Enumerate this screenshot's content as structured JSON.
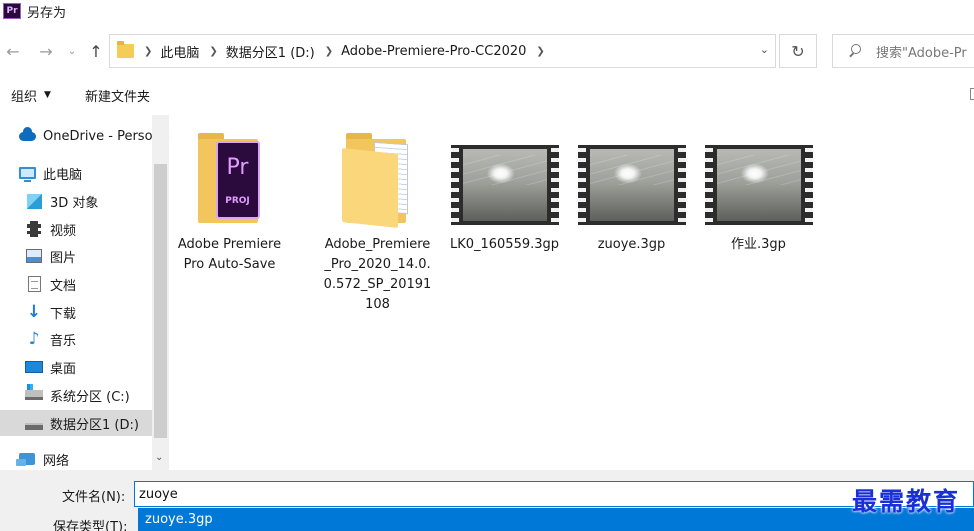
{
  "window": {
    "title": "另存为",
    "app_icon_text": "Pr"
  },
  "address": {
    "crumbs": [
      "此电脑",
      "数据分区1 (D:)",
      "Adobe-Premiere-Pro-CC2020"
    ],
    "search_placeholder": "搜索\"Adobe-Pr"
  },
  "toolbar": {
    "organize": "组织",
    "new_folder": "新建文件夹"
  },
  "nav": {
    "items": [
      {
        "label": "OneDrive - Personal",
        "icon": "onedrive-icon"
      },
      {
        "label": "此电脑",
        "icon": "this-pc-icon"
      },
      {
        "label": "3D 对象",
        "icon": "3d-objects-icon"
      },
      {
        "label": "视频",
        "icon": "videos-icon"
      },
      {
        "label": "图片",
        "icon": "pictures-icon"
      },
      {
        "label": "文档",
        "icon": "documents-icon"
      },
      {
        "label": "下载",
        "icon": "downloads-icon"
      },
      {
        "label": "音乐",
        "icon": "music-icon"
      },
      {
        "label": "桌面",
        "icon": "desktop-icon"
      },
      {
        "label": "系统分区 (C:)",
        "icon": "drive-c-icon"
      },
      {
        "label": "数据分区1 (D:)",
        "icon": "drive-d-icon",
        "selected": true
      },
      {
        "label": "网络",
        "icon": "network-icon"
      }
    ]
  },
  "files": [
    {
      "name": "Adobe Premiere Pro Auto-Save",
      "type": "folder-premiere",
      "badge_top": "Pr",
      "badge_bottom": "PROJ"
    },
    {
      "name": "Adobe_Premiere_Pro_2020_14.0.0.572_SP_20191108",
      "type": "folder"
    },
    {
      "name": "LK0_160559.3gp",
      "type": "video"
    },
    {
      "name": "zuoye.3gp",
      "type": "video"
    },
    {
      "name": "作业.3gp",
      "type": "video"
    }
  ],
  "save": {
    "filename_label": "文件名(N):",
    "filename_value": "zuoye",
    "filetype_label": "保存类型(T):",
    "suggestion": "zuoye.3gp"
  },
  "watermark": "最需教育",
  "colors": {
    "accent": "#0078d7",
    "selected_nav": "#d9d9d9",
    "folder": "#f2c65c"
  }
}
